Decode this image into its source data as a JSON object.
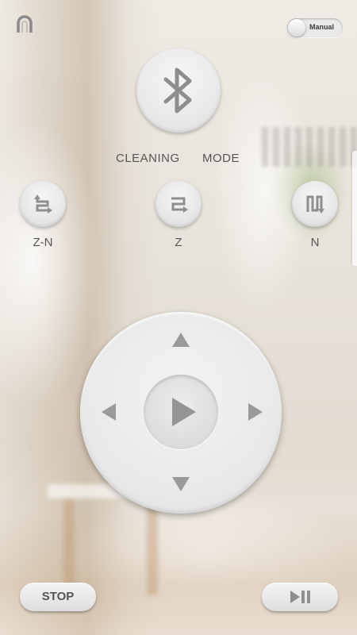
{
  "toggle": {
    "label": "Manual",
    "state": "off"
  },
  "main_button": {
    "icon": "bluetooth-icon"
  },
  "header_labels": {
    "cleaning": "CLEANING",
    "mode": "MODE"
  },
  "modes": [
    {
      "label": "Z-N",
      "icon": "zigzag-return-icon"
    },
    {
      "label": "Z",
      "icon": "zigzag-icon"
    },
    {
      "label": "N",
      "icon": "n-pattern-icon"
    }
  ],
  "dpad": {
    "up_icon": "arrow-up-icon",
    "down_icon": "arrow-down-icon",
    "left_icon": "arrow-left-icon",
    "right_icon": "arrow-right-icon",
    "center_icon": "play-icon"
  },
  "bottom": {
    "stop_label": "STOP",
    "play_pause_icon": "play-pause-icon"
  },
  "colors": {
    "icon_gray": "#8e8e8e",
    "button_face": "#e9e9e9",
    "text": "#555555"
  }
}
